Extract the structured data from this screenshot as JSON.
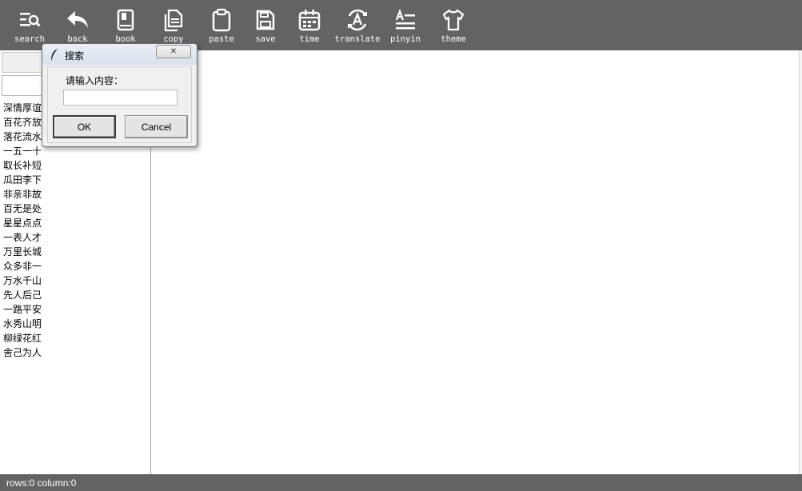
{
  "toolbar": {
    "buttons": [
      {
        "label": "search",
        "icon": "search-icon"
      },
      {
        "label": "back",
        "icon": "back-arrow-icon"
      },
      {
        "label": "book",
        "icon": "book-icon"
      },
      {
        "label": "copy",
        "icon": "copy-icon"
      },
      {
        "label": "paste",
        "icon": "clipboard-icon"
      },
      {
        "label": "save",
        "icon": "save-icon"
      },
      {
        "label": "time",
        "icon": "calendar-icon"
      },
      {
        "label": "translate",
        "icon": "translate-icon"
      },
      {
        "label": "pinyin",
        "icon": "text-align-icon"
      },
      {
        "label": "theme",
        "icon": "tshirt-icon"
      }
    ]
  },
  "sidebar": {
    "search_value": "",
    "idioms": [
      "深情厚谊",
      "百花齐放",
      "落花流水",
      "一五一十",
      "取长补短",
      "瓜田李下",
      "非亲非故",
      "百无是处",
      "星星点点",
      "一表人才",
      "万里长城",
      "众多非一",
      "万水千山",
      "先人后己",
      "一路平安",
      "水秀山明",
      "柳绿花红",
      "舍己为人"
    ]
  },
  "dialog": {
    "title": "搜索",
    "prompt": "请输入内容：",
    "input_value": "",
    "ok_label": "OK",
    "cancel_label": "Cancel",
    "close_glyph": "✕"
  },
  "status": {
    "text": "rows:0 column:0"
  },
  "colors": {
    "toolbar_bg": "#636363",
    "status_bg": "#636363",
    "icon": "#ffffff"
  }
}
